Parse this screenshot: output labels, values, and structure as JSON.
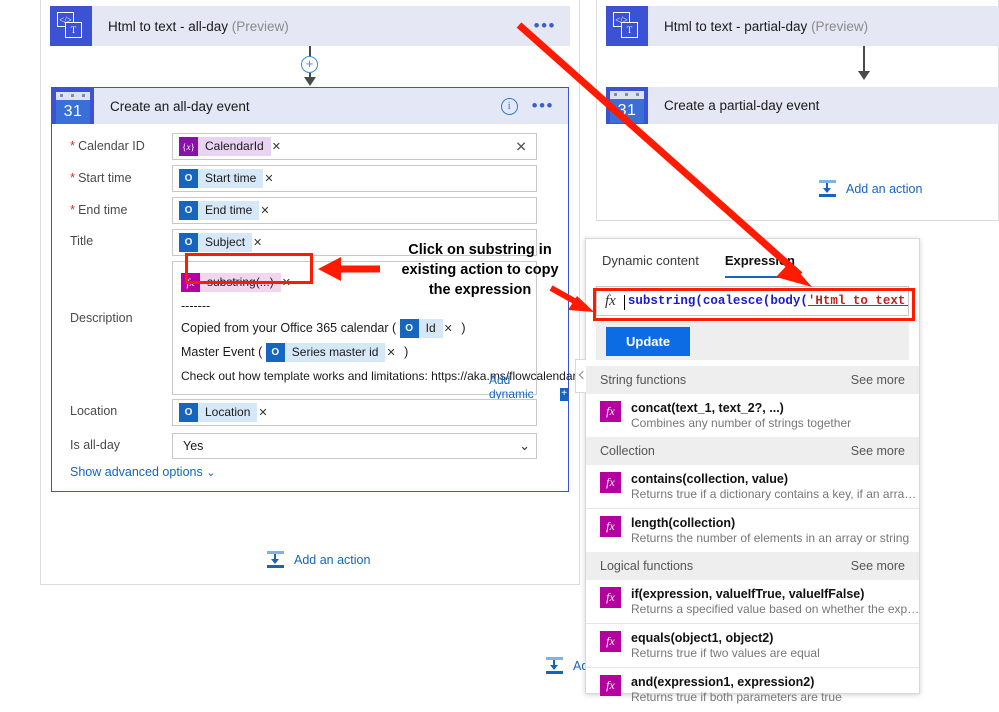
{
  "left_flow": {
    "html_to_text_card": {
      "title": "Html to text - all-day",
      "preview": "(Preview)",
      "icon": "html-to-text-icon",
      "glyph_code": "</>",
      "glyph_text": "T"
    },
    "create_event_card": {
      "title": "Create an all-day event",
      "icon": "calendar-31-icon",
      "day_number": "31",
      "info_icon": "info-icon",
      "more_icon": "more-options-icon"
    },
    "form": {
      "fields": [
        {
          "label": "Calendar ID",
          "required": true,
          "token": {
            "kind": "var",
            "icon": "{x}",
            "label": "CalendarId"
          },
          "has_clear": true
        },
        {
          "label": "Start time",
          "required": true,
          "token": {
            "kind": "ol",
            "label": "Start time"
          }
        },
        {
          "label": "End time",
          "required": true,
          "token": {
            "kind": "ol",
            "label": "End time"
          }
        },
        {
          "label": "Title",
          "required": false,
          "token": {
            "kind": "ol",
            "label": "Subject"
          }
        }
      ],
      "description": {
        "label": "Description",
        "expr_token": {
          "kind": "expr",
          "label": "substring(...)"
        },
        "dashes": "-------",
        "line_copied_prefix": "Copied from your Office 365 calendar (",
        "line_copied_token": "Id",
        "line_copied_suffix": ")",
        "line_master_prefix": "Master Event (",
        "line_master_token": "Series master id",
        "line_master_suffix": ")",
        "line_check": "Check out how template works and limitations: https://aka.ms/flowcalendar",
        "add_dynamic_content": "Add dynamic content"
      },
      "location": {
        "label": "Location",
        "token": {
          "kind": "ol",
          "label": "Location"
        }
      },
      "is_all_day": {
        "label": "Is all-day",
        "value": "Yes"
      },
      "show_advanced": "Show advanced options"
    },
    "add_action": "Add an action"
  },
  "right_flow": {
    "html_to_text_card": {
      "title": "Html to text - partial-day",
      "preview": "(Preview)",
      "glyph_code": "</>",
      "glyph_text": "T"
    },
    "create_event_card": {
      "title": "Create a partial-day event",
      "day_number": "31"
    },
    "add_action": "Add an action"
  },
  "bottom_add_action": "Add",
  "flyout": {
    "tabs": [
      {
        "label": "Dynamic content",
        "active": false
      },
      {
        "label": "Expression",
        "active": true
      }
    ],
    "fx_symbol": "fx",
    "expression_prefix": "substring(coalesce(body(",
    "expression_literal": "'Html_to_text_-_all-d",
    "update_button": "Update",
    "sections": [
      {
        "title": "String functions",
        "see_more": "See more",
        "items": [
          {
            "icon": "fx",
            "signature": "concat(text_1, text_2?, ...)",
            "description": "Combines any number of strings together"
          }
        ]
      },
      {
        "title": "Collection",
        "see_more": "See more",
        "items": [
          {
            "icon": "fx",
            "signature": "contains(collection, value)",
            "description": "Returns true if a dictionary contains a key, if an array contai..."
          },
          {
            "icon": "fx",
            "signature": "length(collection)",
            "description": "Returns the number of elements in an array or string"
          }
        ]
      },
      {
        "title": "Logical functions",
        "see_more": "See more",
        "items": [
          {
            "icon": "fx",
            "signature": "if(expression, valueIfTrue, valueIfFalse)",
            "description": "Returns a specified value based on whether the expression r..."
          },
          {
            "icon": "fx",
            "signature": "equals(object1, object2)",
            "description": "Returns true if two values are equal"
          },
          {
            "icon": "fx",
            "signature": "and(expression1, expression2)",
            "description": "Returns true if both parameters are true"
          }
        ]
      }
    ]
  },
  "annotation": {
    "line1": "Click on substring in",
    "line2": "existing action to copy",
    "line3": "the expression",
    "color": "#ff1a00"
  }
}
